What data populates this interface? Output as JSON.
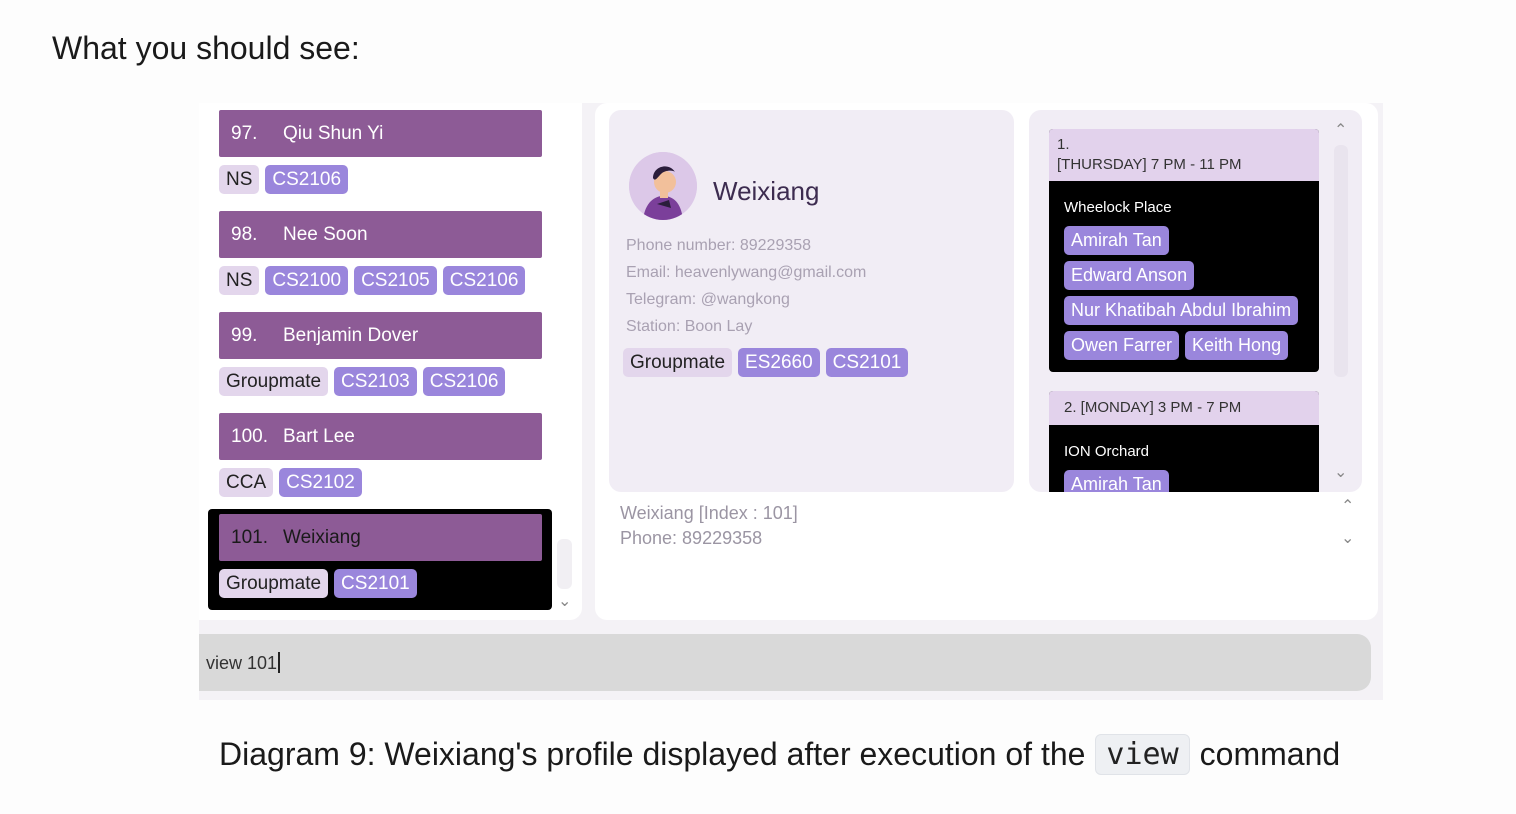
{
  "heading": "What you should see:",
  "list": [
    {
      "index": "97.",
      "name": "Qiu Shun Yi",
      "tags": [
        {
          "label": "NS",
          "style": "light"
        },
        {
          "label": "CS2106",
          "style": "purple"
        }
      ]
    },
    {
      "index": "98.",
      "name": "Nee Soon",
      "tags": [
        {
          "label": "NS",
          "style": "light"
        },
        {
          "label": "CS2100",
          "style": "purple"
        },
        {
          "label": "CS2105",
          "style": "purple"
        },
        {
          "label": "CS2106",
          "style": "purple"
        }
      ]
    },
    {
      "index": "99.",
      "name": "Benjamin Dover",
      "tags": [
        {
          "label": "Groupmate",
          "style": "light"
        },
        {
          "label": "CS2103",
          "style": "purple"
        },
        {
          "label": "CS2106",
          "style": "purple"
        }
      ]
    },
    {
      "index": "100.",
      "name": "Bart Lee",
      "tags": [
        {
          "label": "CCA",
          "style": "light"
        },
        {
          "label": "CS2102",
          "style": "purple"
        }
      ]
    },
    {
      "index": "101.",
      "name": "Weixiang",
      "tags": [
        {
          "label": "Groupmate",
          "style": "light"
        },
        {
          "label": "CS2101",
          "style": "purple"
        }
      ]
    }
  ],
  "profile": {
    "name": "Weixiang",
    "phone": "Phone number: 89229358",
    "email": "Email: heavenlywang@gmail.com",
    "telegram": "Telegram: @wangkong",
    "station": "Station: Boon Lay",
    "tags": [
      {
        "label": "Groupmate",
        "style": "light"
      },
      {
        "label": "ES2660",
        "style": "purple"
      },
      {
        "label": "CS2101",
        "style": "purple"
      }
    ]
  },
  "schedule": [
    {
      "header_line1": "1.",
      "header_line2": "[THURSDAY] 7 PM - 11 PM",
      "venue": "Wheelock Place",
      "members": [
        "Amirah Tan",
        "Edward Anson",
        "Nur Khatibah Abdul Ibrahim",
        "Owen Farrer",
        "Keith Hong"
      ]
    },
    {
      "header_line1": "2. [MONDAY] 3 PM - 7 PM",
      "venue": "ION Orchard",
      "members": [
        "Amirah Tan"
      ]
    }
  ],
  "result": {
    "line1": "Weixiang [Index : 101]",
    "line2": "Phone: 89229358"
  },
  "command": {
    "value": "view 101"
  },
  "caption": {
    "before": "Diagram 9: Weixiang's profile displayed after execution of the",
    "code": "view",
    "after": "command"
  },
  "colors": {
    "name_bar": "#8d5b96",
    "tag_light": "#e3d6ec",
    "tag_purple": "#9a86dc",
    "selected_bg": "#000000"
  }
}
